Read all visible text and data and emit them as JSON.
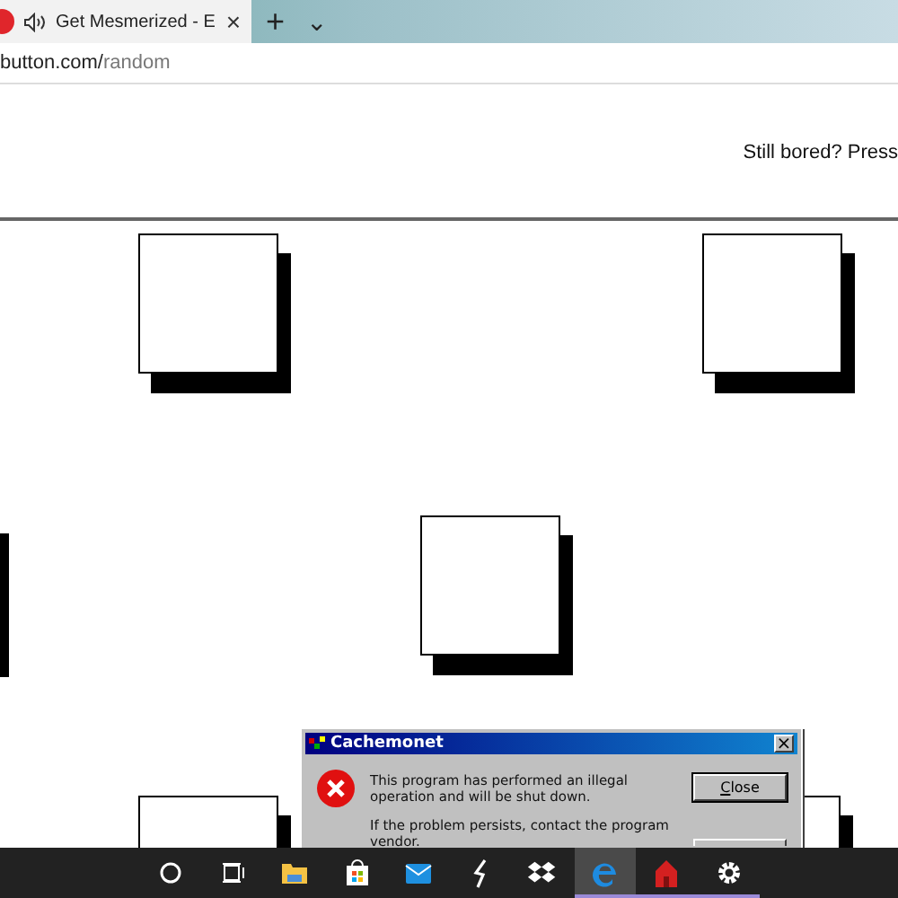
{
  "browser": {
    "tab": {
      "title": "Get Mesmerized - E",
      "audio": true,
      "close": "×"
    },
    "new_tab": "+",
    "tab_menu": "⌄",
    "url": {
      "host": "button.com/",
      "path": "random"
    }
  },
  "page": {
    "side_text": "Still bored? Press"
  },
  "dialog": {
    "title": "Cachemonet",
    "close": "×",
    "messages": [
      "This program has performed an illegal operation and will be shut down.",
      "If the problem persists, contact the program vendor."
    ],
    "buttons": [
      {
        "label": "Close",
        "kind": "default"
      },
      {
        "kind": "plain"
      }
    ]
  },
  "taskbar": {
    "items": [
      {
        "kind": "cortana",
        "active": false,
        "running": false
      },
      {
        "kind": "taskview",
        "active": false,
        "running": false
      },
      {
        "kind": "folder",
        "active": false,
        "running": false
      },
      {
        "kind": "store",
        "active": false,
        "running": false
      },
      {
        "kind": "mail",
        "active": false,
        "running": false
      },
      {
        "kind": "bolt",
        "active": false,
        "running": false
      },
      {
        "kind": "dropbox",
        "active": false,
        "running": false
      },
      {
        "kind": "edge",
        "active": true,
        "running": true
      },
      {
        "kind": "house",
        "active": false,
        "running": true
      },
      {
        "kind": "gear",
        "active": false,
        "running": true
      }
    ]
  }
}
